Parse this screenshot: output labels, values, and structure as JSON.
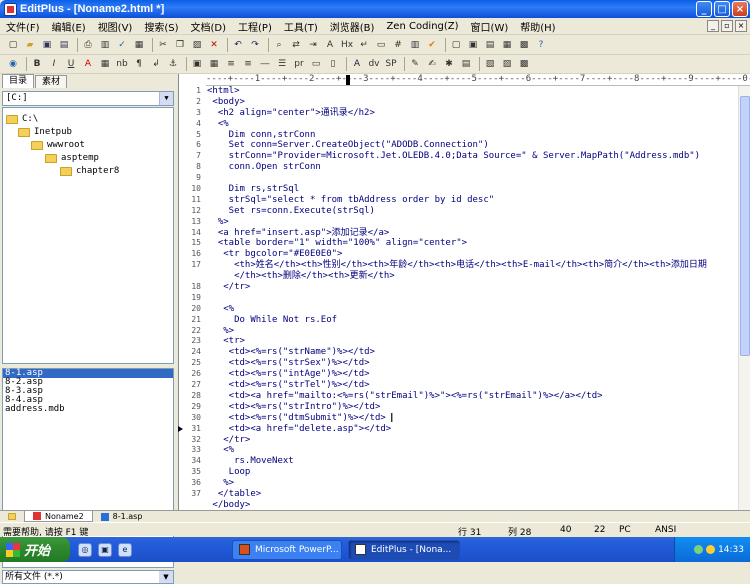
{
  "window": {
    "title": "EditPlus - [Noname2.html *]",
    "min": "_",
    "max": "□",
    "close": "×"
  },
  "menu": [
    "文件(F)",
    "编辑(E)",
    "视图(V)",
    "搜索(S)",
    "文档(D)",
    "工程(P)",
    "工具(T)",
    "浏览器(B)",
    "Zen Coding(Z)",
    "窗口(W)",
    "帮助(H)"
  ],
  "left_panel": {
    "tabs": [
      "目录",
      "素材"
    ],
    "drive": "[C:]",
    "tree": [
      "C:\\",
      "Inetpub",
      "wwwroot",
      "asptemp",
      "chapter8"
    ],
    "files": [
      "8-1.asp",
      "8-2.asp",
      "8-3.asp",
      "8-4.asp",
      "address.mdb"
    ],
    "selected_file": "8-1.asp",
    "filter": "所有文件 (*.*)"
  },
  "editor": {
    "ruler": "----+----1----+----2----+----3----+----4----+----5----+----6----+----7----+----8----+----9----+----0----",
    "line_numbers": [
      "1",
      "2",
      "3",
      "4",
      "5",
      "6",
      "7",
      "8",
      "9",
      "10",
      "11",
      "12",
      "13",
      "14",
      "15",
      "16",
      "17",
      "",
      "18",
      "19",
      "20",
      "21",
      "22",
      "23",
      "24",
      "25",
      "26",
      "27",
      "28",
      "29",
      "30",
      "31",
      "32",
      "33",
      "34",
      "35",
      "36",
      "37",
      ""
    ],
    "current_line_marker": "31",
    "lines": [
      "<html>",
      " <body>",
      "  <h2 align=\"center\">通讯录</h2>",
      "  <%",
      "    Dim conn,strConn",
      "    Set conn=Server.CreateObject(\"ADODB.Connection\")",
      "    strConn=\"Provider=Microsoft.Jet.OLEDB.4.0;Data Source=\" & Server.MapPath(\"Address.mdb\")",
      "    conn.Open strConn",
      "",
      "    Dim rs,strSql",
      "    strSql=\"select * from tbAddress order by id desc\"",
      "    Set rs=conn.Execute(strSql)",
      "  %>",
      "  <a href=\"insert.asp\">添加记录</a>",
      "  <table border=\"1\" width=\"100%\" align=\"center\">",
      "   <tr bgcolor=\"#E0E0E0\">",
      "     <th>姓名</th><th>性别</th><th>年龄</th><th>电话</th><th>E-mail</th><th>简介</th><th>添加日期",
      "     </th><th>删除</th><th>更新</th>",
      "   </tr>",
      "",
      "   <%",
      "     Do While Not rs.Eof",
      "   %>",
      "   <tr>",
      "    <td><%=rs(\"strName\")%></td>",
      "    <td><%=rs(\"strSex\")%></td>",
      "    <td><%=rs(\"intAge\")%></td>",
      "    <td><%=rs(\"strTel\")%></td>",
      "    <td><a href=\"mailto:<%=rs(\"strEmail\")%>\"><%=rs(\"strEmail\")%></a></td>",
      "    <td><%=rs(\"strIntro\")%></td>",
      "    <td><%=rs(\"dtmSubmit\")%></td>",
      "    <td><a href=\"delete.asp\"></td>",
      "   </tr>",
      "   <%",
      "     rs.MoveNext",
      "    Loop",
      "   %>",
      "  </table>",
      " </body>"
    ]
  },
  "doc_tabs": [
    "Noname2",
    "8-1.asp"
  ],
  "status": {
    "help": "需要帮助, 请按 F1 键",
    "row": "行 31",
    "col": "列 28",
    "n1": "40",
    "n2": "22",
    "mode": "PC",
    "enc": "ANSI"
  },
  "taskbar": {
    "start": "开始",
    "tasks": [
      "Microsoft PowerP...",
      "EditPlus - [Nona..."
    ],
    "clock": "14:33"
  }
}
